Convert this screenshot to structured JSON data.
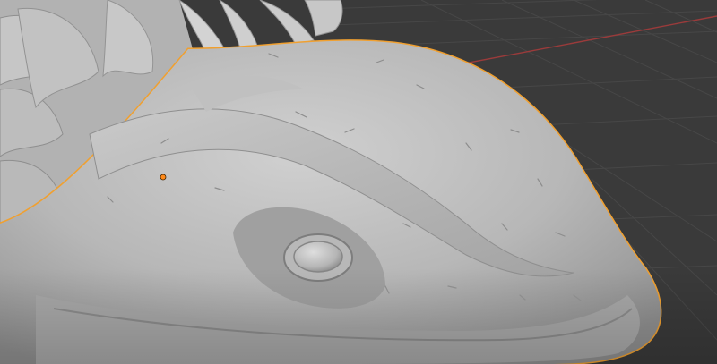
{
  "viewport": {
    "background_color": "#3a3a3a",
    "grid_line_color": "#454545",
    "x_axis_color": "#9a3b3b",
    "selection_outline_color": "#f0a030",
    "origin_marker_color": "#ff8a1a",
    "mesh_base_color": "#b4b4b4",
    "mesh_highlight_color": "#d2d2d2",
    "mesh_shadow_color": "#8c8c8c"
  },
  "object": {
    "selected": true,
    "shading": "solid",
    "subject": "sculpted-fish-head"
  }
}
